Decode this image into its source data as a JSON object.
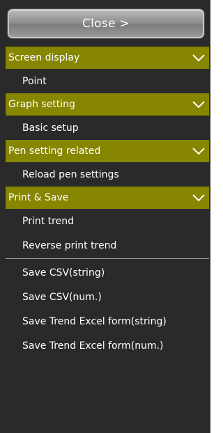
{
  "close_button": {
    "label": "Close >"
  },
  "sections": [
    {
      "header": "Screen display",
      "items": [
        "Point"
      ]
    },
    {
      "header": "Graph setting",
      "items": [
        "Basic setup"
      ]
    },
    {
      "header": "Pen setting related",
      "items": [
        "Reload pen settings"
      ]
    },
    {
      "header": "Print & Save",
      "items": [
        "Print trend",
        "Reverse print trend"
      ]
    }
  ],
  "save_items": [
    "Save CSV(string)",
    "Save CSV(num.)",
    "Save Trend Excel form(string)",
    "Save Trend Excel form(num.)"
  ],
  "colors": {
    "panel_bg": "#2a2a2a",
    "section_header_bg": "#868600",
    "text": "#ffffff",
    "divider": "#9a9a9a"
  },
  "icons": {
    "section_toggle": "chevron-down-icon"
  }
}
